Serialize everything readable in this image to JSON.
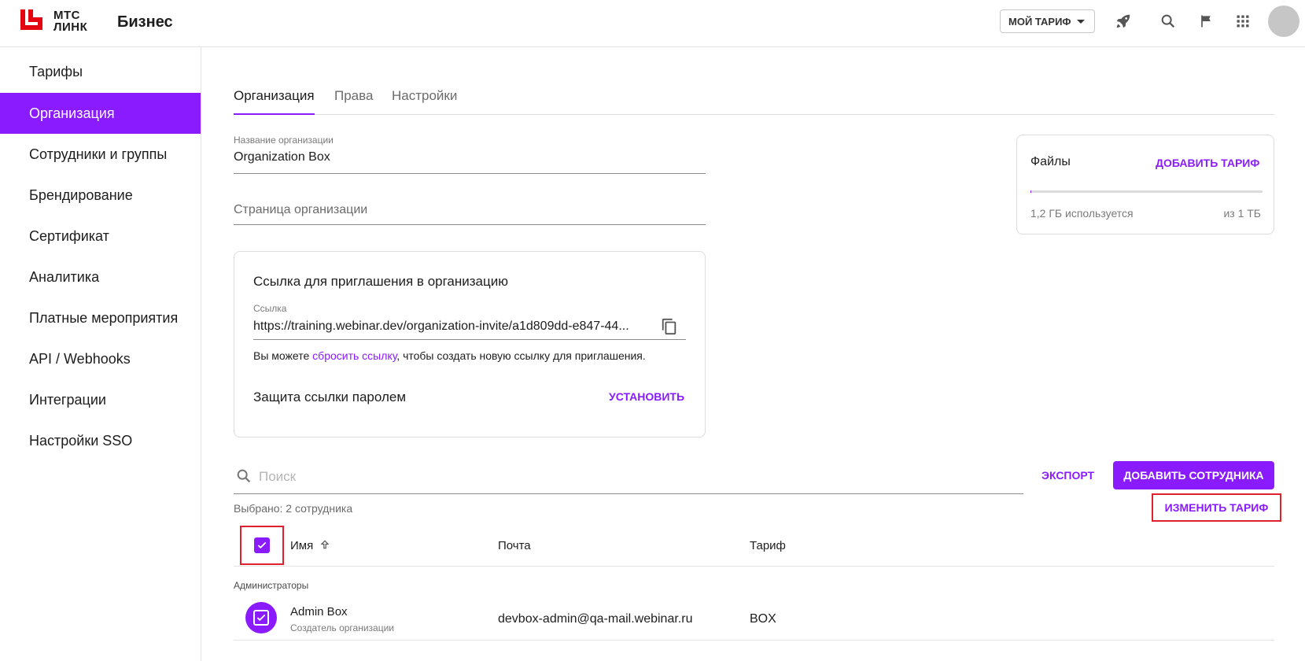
{
  "header": {
    "logo_line1": "МТС",
    "logo_line2": "ЛИНК",
    "product": "Бизнес",
    "tariff_button": "МОЙ ТАРИФ",
    "icons": [
      "rocket-icon",
      "search-icon",
      "flag-icon",
      "apps-grid-icon",
      "avatar"
    ]
  },
  "sidebar": {
    "items": [
      {
        "label": "Тарифы",
        "active": false
      },
      {
        "label": "Организация",
        "active": true
      },
      {
        "label": "Сотрудники и группы",
        "active": false
      },
      {
        "label": "Брендирование",
        "active": false
      },
      {
        "label": "Сертификат",
        "active": false
      },
      {
        "label": "Аналитика",
        "active": false
      },
      {
        "label": "Платные мероприятия",
        "active": false
      },
      {
        "label": "API / Webhooks",
        "active": false
      },
      {
        "label": "Интеграции",
        "active": false
      },
      {
        "label": "Настройки SSO",
        "active": false
      }
    ]
  },
  "tabs": [
    {
      "label": "Организация",
      "active": true
    },
    {
      "label": "Права",
      "active": false
    },
    {
      "label": "Настройки",
      "active": false
    }
  ],
  "org_name": {
    "label": "Название организации",
    "value": "Organization Box"
  },
  "org_page": {
    "placeholder": "Страница организации"
  },
  "invite": {
    "title": "Ссылка для приглашения в организацию",
    "link_label": "Ссылка",
    "link_value": "https://training.webinar.dev/organization-invite/a1d809dd-e847-44...",
    "hint_before": "Вы можете ",
    "hint_link": "сбросить ссылку",
    "hint_after": ", чтобы создать новую ссылку для приглашения.",
    "password_title": "Защита ссылки паролем",
    "password_button": "УСТАНОВИТЬ"
  },
  "files": {
    "title": "Файлы",
    "add_button": "ДОБАВИТЬ ТАРИФ",
    "used": "1,2 ГБ используется",
    "total": "из 1 ТБ",
    "usage_fraction": 0.0012
  },
  "toolbar": {
    "search_placeholder": "Поиск",
    "export_button": "ЭКСПОРТ",
    "add_employee_button": "ДОБАВИТЬ СОТРУДНИКА",
    "selected_text": "Выбрано: 2 сотрудника",
    "change_tariff_button": "ИЗМЕНИТЬ ТАРИФ"
  },
  "table": {
    "columns": [
      "Имя",
      "Почта",
      "Тариф"
    ],
    "group_label": "Администраторы",
    "rows": [
      {
        "name": "Admin Box",
        "role": "Создатель организации",
        "email": "devbox-admin@qa-mail.webinar.ru",
        "tariff": "BOX",
        "selected": true
      }
    ]
  },
  "colors": {
    "accent": "#8a1bff",
    "highlight": "#e0202c",
    "logo": "#e30611"
  }
}
